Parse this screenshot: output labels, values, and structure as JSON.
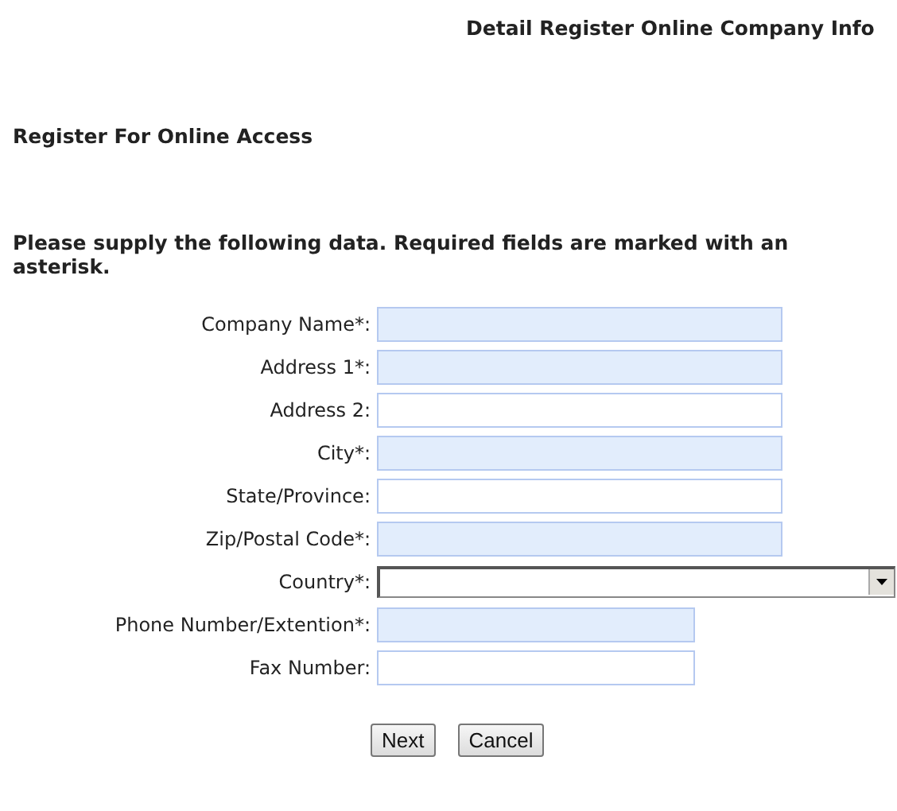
{
  "page_title": "Detail Register Online Company Info",
  "section_heading": "Register For Online Access",
  "instructions": "Please supply the following data. Required fields are marked with an asterisk.",
  "fields": [
    {
      "label": "Company Name*:",
      "kind": "text",
      "required": true
    },
    {
      "label": "Address 1*:",
      "kind": "text",
      "required": true
    },
    {
      "label": "Address 2:",
      "kind": "text",
      "required": false
    },
    {
      "label": "City*:",
      "kind": "text",
      "required": true
    },
    {
      "label": "State/Province:",
      "kind": "text",
      "required": false
    },
    {
      "label": "Zip/Postal Code*:",
      "kind": "text",
      "required": true
    },
    {
      "label": "Country*:",
      "kind": "select"
    },
    {
      "label": "Phone Number/Extention*:",
      "kind": "short",
      "required": true
    },
    {
      "label": "Fax Number:",
      "kind": "short",
      "required": false
    }
  ],
  "buttons": [
    "Next",
    "Cancel"
  ]
}
